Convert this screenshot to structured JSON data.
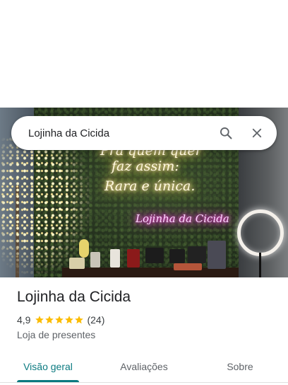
{
  "search": {
    "value": "Lojinha da Cicida"
  },
  "hero": {
    "neon_line1": "Pra quem quer",
    "neon_line2": "faz assim:",
    "neon_line3": "Rara e única.",
    "neon_pink": "Lojinha da Cicida"
  },
  "place": {
    "title": "Lojinha da Cicida",
    "rating": "4,9",
    "stars": 5,
    "reviews": "(24)",
    "category": "Loja de presentes"
  },
  "tabs": [
    {
      "label": "Visão geral",
      "active": true
    },
    {
      "label": "Avaliações",
      "active": false
    },
    {
      "label": "Sobre",
      "active": false
    }
  ],
  "colors": {
    "accent": "#0b7a80",
    "star": "#fbbc04"
  }
}
